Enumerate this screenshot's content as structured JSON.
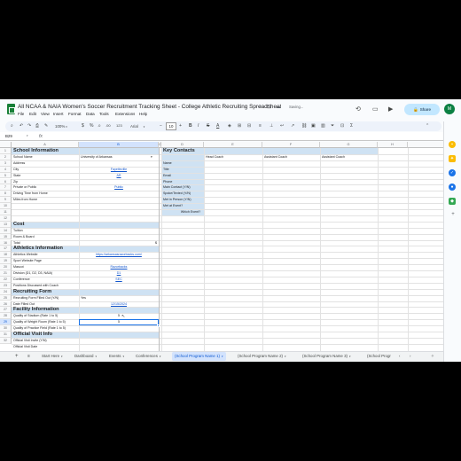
{
  "window": {
    "title": "All NCAA & NAIA Women's Soccer Recruitment Tracking Sheet - College Athletic Recruiting Spreadsheet",
    "saving_status": "Saving...",
    "menu": [
      "File",
      "Edit",
      "View",
      "Insert",
      "Format",
      "Data",
      "Tools",
      "Extensions",
      "Help"
    ],
    "share_label": "Share",
    "avatar_initial": "M"
  },
  "toolbar": {
    "zoom": "100%",
    "currency": "$",
    "percent": "%",
    "dec_less": ".0",
    "dec_more": ".00",
    "number_format": "123",
    "font": "Arial",
    "font_size": "10",
    "bold": "B",
    "italic": "I",
    "strike": "S",
    "text_color": "A"
  },
  "formula_bar": {
    "cell_ref": "B29",
    "fx": "fx"
  },
  "columns": [
    "A",
    "B",
    "C",
    "D",
    "E",
    "F",
    "G",
    "H"
  ],
  "rows": [
    "1",
    "2",
    "3",
    "4",
    "5",
    "6",
    "7",
    "8",
    "9",
    "10",
    "11",
    "12",
    "13",
    "14",
    "15",
    "16",
    "17",
    "18",
    "19",
    "20",
    "21",
    "22",
    "23",
    "24",
    "25",
    "26",
    "27",
    "28",
    "29",
    "30",
    "31",
    "32"
  ],
  "left_sheet": {
    "sections": {
      "school_info": "School Information",
      "cost": "Cost",
      "athletics_info": "Athletics Information",
      "recruiting_form": "Recruiting Form",
      "facility_info": "Facility Information",
      "official_visit": "Official Visit Info"
    },
    "fields": {
      "school_name": "School Name",
      "address": "Address",
      "city": "City",
      "state": "State",
      "zip": "Zip",
      "private_public": "Private or Public",
      "driving_time": "Driving Time from Home",
      "miles": "Miles from Home",
      "tuition": "Tuition",
      "room_board": "Room & Board",
      "total": "Total",
      "athletics_website": "Athletics Website",
      "sport_website": "Sport Website Page",
      "mascot": "Mascot",
      "division": "Division (D1, D2, D3, NAIA)",
      "conference": "Conference",
      "positions": "Positions Discussed with Coach",
      "form_filled": "Recruiting Form Filled Out (Y/N)",
      "date_filled": "Date Filled Out",
      "stadium": "Quality of Stadium (Rate 1 to 5)",
      "weight_room": "Quality of Weight Room (Rate 1 to 5)",
      "practice_field": "Quality of Practice Field (Rate 1 to 5)",
      "visit_invite": "Official Visit Invite (Y/N)",
      "visit_date": "Official Visit Date"
    },
    "values": {
      "school_name": "University of Arkansas",
      "city": "Fayetteville",
      "state": "AR",
      "private_public": "Public",
      "total": "$",
      "athletics_website": "https://arkansasrazorbacks.com/",
      "mascot": "Razorbacks",
      "division": "D1",
      "conference": "SEC",
      "form_filled": "Yes",
      "date_filled": "12/15/2024",
      "stadium": "5",
      "weight_room": "4",
      "practice_field": "5"
    }
  },
  "right_sheet": {
    "title": "Key Contacts",
    "column_headers": [
      "Head Coach",
      "Assistant Coach",
      "Assistant Coach"
    ],
    "fields": [
      "Name",
      "Title",
      "Email",
      "Phone",
      "Main Contact (Y/N)",
      "Spoke/Texted (Y/N)",
      "Met in Person (Y/N)",
      "Met at Event?"
    ],
    "which_event": "Which Event?"
  },
  "tabs": {
    "add": "+",
    "all_sheets": "≡",
    "items": [
      "Start Here",
      "Dashboard",
      "Events",
      "Conferences",
      "(School Program Name 1)",
      "(School Program Name 2)",
      "(School Program Name 3)",
      "(School Progr"
    ],
    "active_index": 4
  },
  "colors": {
    "accent": "#1a73e8",
    "section_fill": "#cfe2f3",
    "share": "#c2e7ff",
    "avatar": "#0b8043"
  }
}
